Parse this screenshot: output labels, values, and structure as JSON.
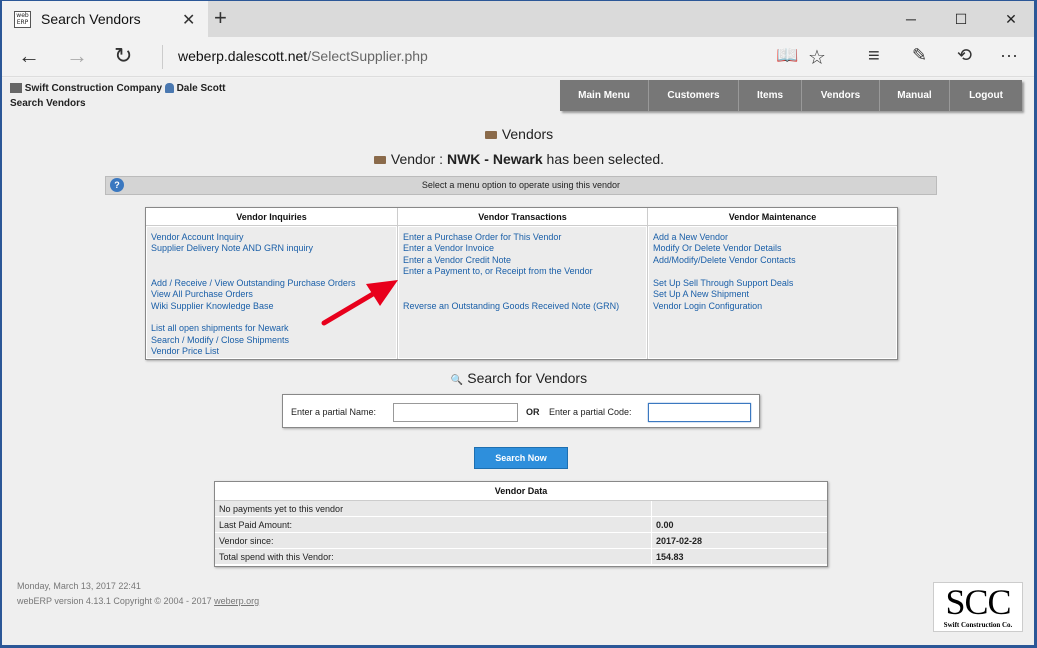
{
  "browser": {
    "tab_title": "Search Vendors",
    "favicon_text": "web ERP",
    "url_host": "weberp.dalescott.net",
    "url_path": "/SelectSupplier.php",
    "icons": [
      "back-arrow-icon",
      "forward-arrow-icon",
      "refresh-icon",
      "reading-view-icon",
      "favorite-star-icon",
      "hub-icon",
      "web-note-icon",
      "share-icon",
      "more-icon"
    ]
  },
  "header": {
    "company": "Swift Construction Company",
    "user": "Dale Scott",
    "page_name": "Search Vendors"
  },
  "menu": [
    "Main Menu",
    "Customers",
    "Items",
    "Vendors",
    "Manual",
    "Logout"
  ],
  "main": {
    "title": "Vendors",
    "selected_prefix": "Vendor : ",
    "selected_vendor": "NWK - Newark",
    "selected_suffix": " has been selected.",
    "info": "Select a menu option to operate using this vendor"
  },
  "columns": [
    {
      "title": "Vendor Inquiries",
      "links": [
        "Vendor Account Inquiry",
        "Supplier Delivery Note AND GRN inquiry",
        "Add / Receive / View Outstanding Purchase Orders",
        "View All Purchase Orders",
        "Wiki Supplier Knowledge Base",
        "List all open shipments for Newark",
        "Search / Modify / Close Shipments",
        "Vendor Price List"
      ]
    },
    {
      "title": "Vendor Transactions",
      "links": [
        "Enter a Purchase Order for This Vendor",
        "Enter a Vendor Invoice",
        "Enter a Vendor Credit Note",
        "Enter a Payment to, or Receipt from the Vendor",
        "Reverse an Outstanding Goods Received Note (GRN)"
      ]
    },
    {
      "title": "Vendor Maintenance",
      "links": [
        "Add a New Vendor",
        "Modify Or Delete Vendor Details",
        "Add/Modify/Delete Vendor Contacts",
        "Set Up Sell Through Support Deals",
        "Set Up A New Shipment",
        "Vendor Login Configuration"
      ]
    }
  ],
  "search": {
    "title": "Search for Vendors",
    "name_label": "Enter a partial Name:",
    "name_value": "",
    "or_label": "OR",
    "code_label": "Enter a partial Code:",
    "code_value": "",
    "button": "Search Now"
  },
  "vendor_data": {
    "title": "Vendor Data",
    "rows": [
      {
        "label": "No payments yet to this vendor",
        "value": ""
      },
      {
        "label": "Last Paid Amount:",
        "value": "0.00"
      },
      {
        "label": "Vendor since:",
        "value": "2017-02-28"
      },
      {
        "label": "Total spend with this Vendor:",
        "value": "154.83"
      }
    ]
  },
  "footer": {
    "datetime": "Monday, March 13, 2017 22:41",
    "version_prefix": "webERP version 4.13.1 Copyright © 2004 - 2017 ",
    "version_link": "weberp.org"
  },
  "logo": {
    "big": "SCC",
    "small": "Swift Construction Co."
  },
  "colors": {
    "link": "#1a5fa8",
    "button": "#2e8fdc",
    "menu_bg": "#777777",
    "annotation_arrow": "#e8001c"
  }
}
